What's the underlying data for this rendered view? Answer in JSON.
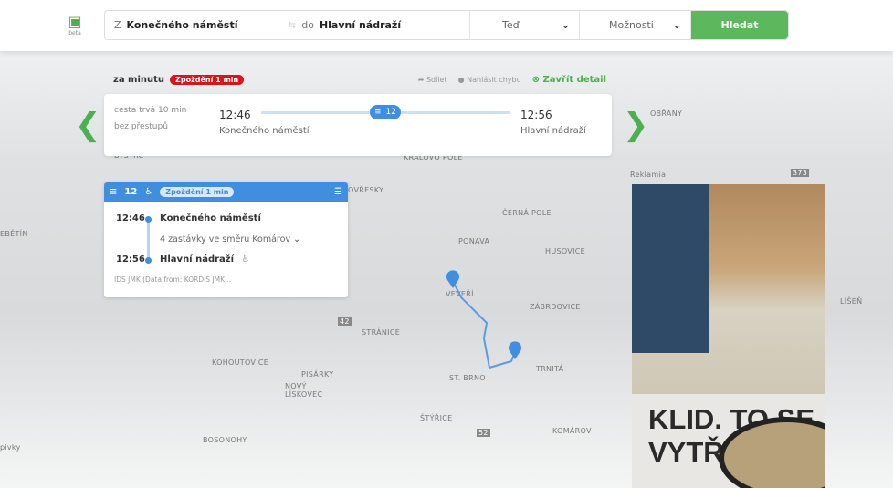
{
  "header": {
    "logo_label": "beta",
    "from_prefix": "Z",
    "from": "Konečného náměstí",
    "to_prefix": "do",
    "to": "Hlavní nádraží",
    "time": "Teď",
    "options": "Možnosti",
    "search_button": "Hledat"
  },
  "summary": {
    "label": "za minutu",
    "delay": "Zpoždění 1 min",
    "share": "Sdílet",
    "report": "Nahlásit chybu",
    "close": "Zavřít detail"
  },
  "trip": {
    "duration": "cesta trvá 10 min",
    "transfers": "bez přestupů",
    "dep_time": "12:46",
    "dep_stop": "Konečného náměstí",
    "line": "12",
    "arr_time": "12:56",
    "arr_stop": "Hlavní nádraží"
  },
  "detail": {
    "line": "12",
    "delay": "Zpoždění 1 min",
    "dep_time": "12:46",
    "dep_stop": "Konečného náměstí",
    "stops": "4 zastávky ve směru Komárov",
    "arr_time": "12:56",
    "arr_stop": "Hlavní nádraží",
    "source": "IDS JMK (Data from: KORDIS JMK..."
  },
  "map_labels": [
    "BYSTRC",
    "KRÁLOVO POLE",
    "OVŘESKY",
    "ČERNÁ POLE",
    "PONAVA",
    "HUSOVICE",
    "VEVEŘÍ",
    "ZÁBRDOVICE",
    "STRÁNICE",
    "KOHOUTOVICE",
    "PISÁRKY",
    "NOVÝ LÍSKOVEC",
    "ŠTÝŘICE",
    "ST. BRNO",
    "TRNITÁ",
    "KOMÁROV",
    "BOSONOHY",
    "EBĚTÍN",
    "OBŘANY",
    "Reklamia",
    "LÍŠEŇ",
    "373",
    "42",
    "52",
    "pivky"
  ],
  "ad": {
    "text1": "KLID. TO SE",
    "text2": "VYTŘ"
  },
  "colors": {
    "accent": "#4caf50",
    "line": "#3f8ee0",
    "delay": "#d9141b"
  }
}
